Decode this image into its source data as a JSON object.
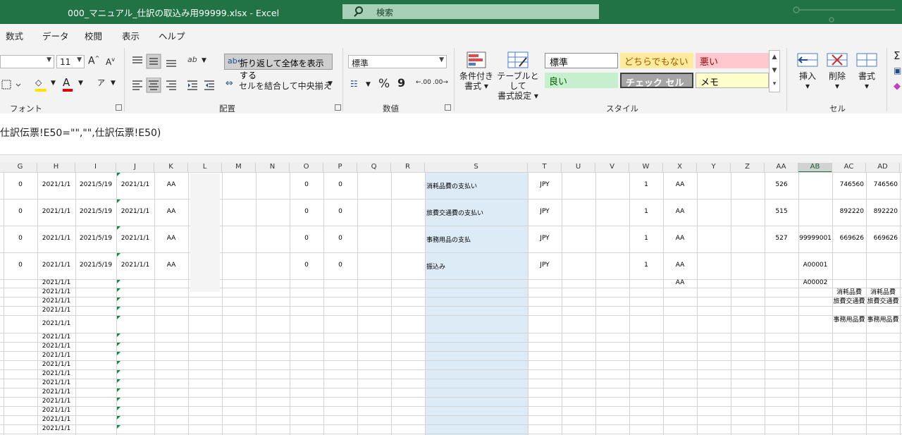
{
  "window": {
    "title": "000_マニュアル_仕訳の取込み用99999.xlsx  -  Excel",
    "search_placeholder": "検索"
  },
  "menu": [
    "数式",
    "データ",
    "校閲",
    "表示",
    "ヘルプ"
  ],
  "ribbon": {
    "font": {
      "label": "フォント",
      "font_size": "11",
      "grow_glyph": "A",
      "shrink_glyph": "A",
      "fill_glyph": "◇",
      "color_glyph": "A",
      "phonetic_glyph": "ア"
    },
    "alignment": {
      "label": "配置",
      "wrap_text": "折り返して全体を表示する",
      "merge_center": "セルを結合して中央揃え",
      "orient_glyph": "ab"
    },
    "number": {
      "label": "数値",
      "format": "標準",
      "percent_glyph": "%",
      "comma_glyph": "9",
      "inc_decimal": ".00",
      "dec_decimal": ".00"
    },
    "styles": {
      "label": "スタイル",
      "conditional": [
        "条件付き",
        "書式"
      ],
      "table": [
        "テーブルとして",
        "書式設定"
      ],
      "cells": [
        "標準",
        "どちらでもない",
        "悪い",
        "良い",
        "チェック セル",
        "メモ"
      ]
    },
    "cells": {
      "label": "セル",
      "insert": "挿入",
      "delete": "削除",
      "format": "書式"
    }
  },
  "formula": "仕訳伝票!E50=\"\",\"\",仕訳伝票!E50)",
  "columns": [
    "G",
    "H",
    "I",
    "J",
    "K",
    "L",
    "M",
    "N",
    "O",
    "P",
    "Q",
    "R",
    "S",
    "T",
    "U",
    "V",
    "W",
    "X",
    "Y",
    "Z",
    "AA",
    "AB",
    "AC",
    "AD"
  ],
  "selected_column": "AB",
  "rows_main": [
    {
      "G": "0",
      "H": "2021/1/1",
      "I": "2021/5/19",
      "J": "2021/1/1",
      "K": "AA",
      "O": "0",
      "P": "0",
      "S": "消耗品費の支払い",
      "T": "JPY",
      "W": "1",
      "X": "AA",
      "AA": "526",
      "AB": "",
      "AC": "746560",
      "AD": "746560"
    },
    {
      "G": "0",
      "H": "2021/1/1",
      "I": "2021/5/19",
      "J": "2021/1/1",
      "K": "AA",
      "O": "0",
      "P": "0",
      "S": "旅費交通費の支払い",
      "T": "JPY",
      "W": "1",
      "X": "AA",
      "AA": "515",
      "AB": "",
      "AC": "892220",
      "AD": "892220"
    },
    {
      "G": "0",
      "H": "2021/1/1",
      "I": "2021/5/19",
      "J": "2021/1/1",
      "K": "AA",
      "O": "0",
      "P": "0",
      "S": "事務用品の支払",
      "T": "JPY",
      "W": "1",
      "X": "AA",
      "AA": "527",
      "AB": "99999001",
      "AC": "669626",
      "AD": "669626"
    },
    {
      "G": "0",
      "H": "2021/1/1",
      "I": "2021/5/19",
      "J": "2021/1/1",
      "K": "AA",
      "O": "0",
      "P": "0",
      "S": "振込み",
      "T": "JPY",
      "W": "1",
      "X": "AA",
      "AA": "",
      "AB": "A00001",
      "AC": "",
      "AD": ""
    }
  ],
  "row_x_extra": "AA",
  "row_ab_extra": "A00002",
  "date_value": "2021/1/1",
  "ac_notes": [
    "消耗品費",
    "旅費交通費",
    "事務用品費"
  ],
  "ad_notes": [
    "消耗品費",
    "旅費交通費",
    "事務用品費"
  ]
}
